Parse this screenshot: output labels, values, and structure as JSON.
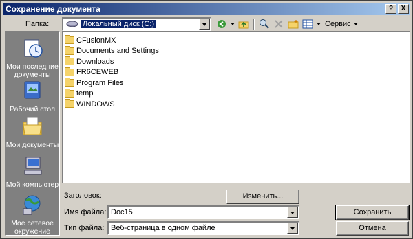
{
  "window": {
    "title": "Сохранение документа",
    "help_btn": "?",
    "close_btn": "X"
  },
  "lookin": {
    "label": "Папка:",
    "value": "Локальный диск (C:)"
  },
  "toolbar": {
    "tools_label": "Сервис"
  },
  "places": [
    {
      "label": "Мои последние документы",
      "icon": "recent-documents-icon"
    },
    {
      "label": "Рабочий стол",
      "icon": "desktop-icon"
    },
    {
      "label": "Мои документы",
      "icon": "my-documents-icon"
    },
    {
      "label": "Мой компьютер",
      "icon": "my-computer-icon"
    },
    {
      "label": "Мое сетевое окружение",
      "icon": "network-places-icon"
    }
  ],
  "files": [
    "CFusionMX",
    "Documents and Settings",
    "Downloads",
    "FR6CEWEB",
    "Program Files",
    "temp",
    "WINDOWS"
  ],
  "form": {
    "title_label": "Заголовок:",
    "change_button": "Изменить...",
    "filename_label": "Имя файла:",
    "filename_value": "Doc15",
    "filetype_label": "Тип файла:",
    "filetype_value": "Веб-страница в одном файле",
    "save_button": "Сохранить",
    "cancel_button": "Отмена"
  },
  "colors": {
    "title_start": "#0a246a",
    "title_end": "#a6caf0",
    "chrome": "#d4d0c8",
    "places_bg": "#808080"
  }
}
